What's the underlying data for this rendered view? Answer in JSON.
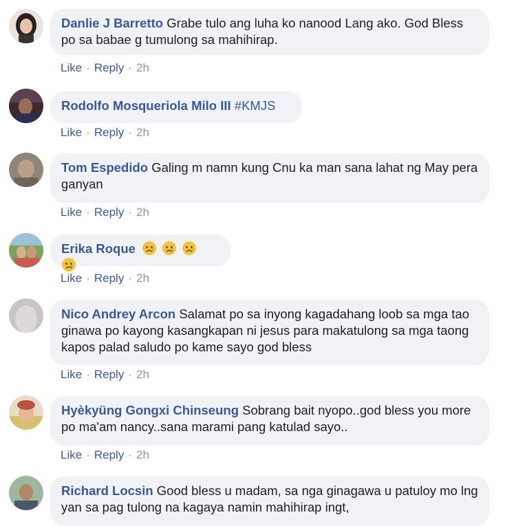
{
  "actions": {
    "like": "Like",
    "reply": "Reply",
    "dot": "·"
  },
  "emoji_name": "crying-face",
  "comments": [
    {
      "author": "Danlie J Barretto",
      "text": "Grabe tulo ang luha ko nanood Lang ako. God Bless po sa babae g tumulong sa mahihirap.",
      "time": "2h"
    },
    {
      "author": "Rodolfo Mosqueriola Milo III",
      "text": "#KMJS",
      "time": "2h"
    },
    {
      "author": "Tom Espedido",
      "text": "Galing m namn kung Cnu ka man sana lahat ng May pera ganyan",
      "time": "2h"
    },
    {
      "author": "Erika Roque",
      "text": "",
      "emoji_count": 4,
      "time": "2h"
    },
    {
      "author": "Nico Andrey Arcon",
      "text": "Salamat po sa inyong kagadahang loob sa mga tao ginawa po kayong kasangkapan ni jesus para makatulong sa mga taong kapos palad saludo po kame sayo god bless",
      "time": "2h"
    },
    {
      "author": "Hyèkyüng Gongxi Chinseung",
      "text": "Sobrang bait nyopo..god bless you more po ma'am nancy..sana marami pang katulad sayo..",
      "time": "2h"
    },
    {
      "author": "Richard Locsin",
      "text": "Good bless u madam, sa nga ginagawa u patuloy mo lng yan sa pag tulong na kagaya namin mahihirap ingt,",
      "time": ""
    }
  ]
}
